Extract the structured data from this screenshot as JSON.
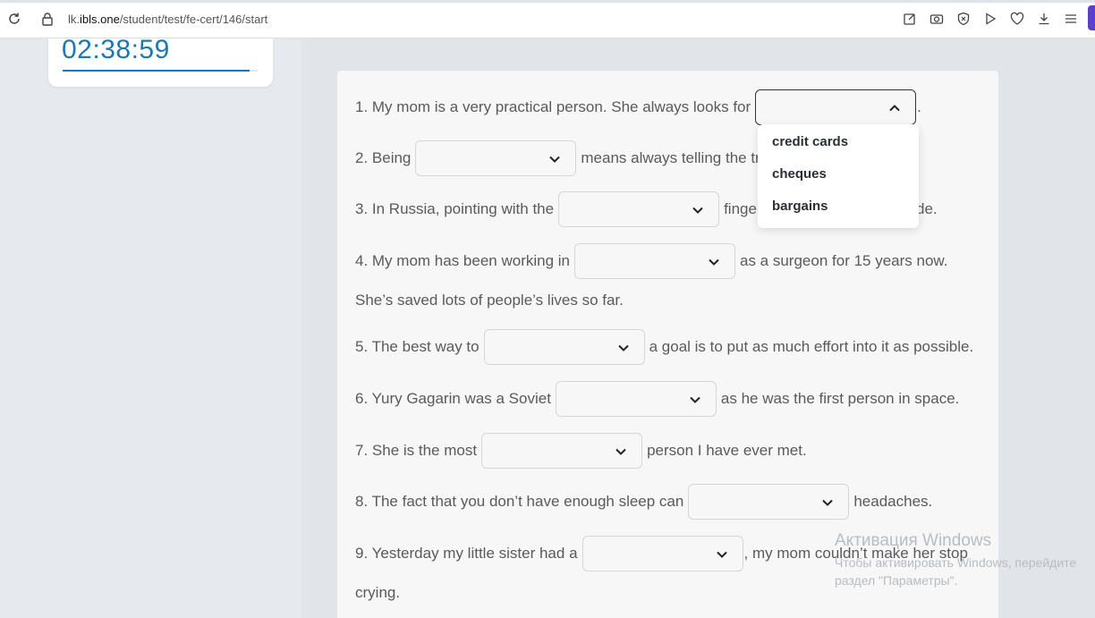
{
  "browser": {
    "url_prefix": "lk.",
    "url_domain": "ibls.one",
    "url_path": "/student/test/fe-cert/146/start",
    "toolbar_icons": [
      "edit-icon",
      "camera-icon",
      "shield-icon",
      "play-icon",
      "heart-icon",
      "download-icon",
      "menu-icon"
    ]
  },
  "timer": {
    "time": "02:38:59",
    "progress": 0.96
  },
  "questions": [
    {
      "before": "1. My mom is a very practical person. She always looks for",
      "after": ".",
      "selected": ""
    },
    {
      "before": "2. Being",
      "after": "means always telling the tr",
      "selected": ""
    },
    {
      "before": "3. In Russia, pointing with the",
      "after": "finge",
      "after2": "de.",
      "selected": ""
    },
    {
      "before": "4. My mom has been working in",
      "after": "as a surgeon for 15 years now.",
      "line2": "She’s saved lots of people’s lives so far.",
      "selected": ""
    },
    {
      "before": "5. The best way to",
      "after": "a goal is to put as much effort into it as possible.",
      "selected": ""
    },
    {
      "before": "6. Yury Gagarin was a Soviet",
      "after": "as he was the first person in space.",
      "selected": ""
    },
    {
      "before": "7. She is the most",
      "after": "person I have ever met.",
      "selected": ""
    },
    {
      "before": "8. The fact that you don’t have enough sleep can",
      "after": "headaches.",
      "selected": ""
    },
    {
      "before": "9. Yesterday my little sister had a",
      "after": ", my mom couldn’t make her stop",
      "line2": "crying.",
      "selected": ""
    }
  ],
  "dropdown_options": [
    "credit cards",
    "cheques",
    "bargains"
  ],
  "watermark": {
    "title": "Активация Windows",
    "line1": "Чтобы активировать Windows, перейдите",
    "line2": "раздел \"Параметры\"."
  }
}
